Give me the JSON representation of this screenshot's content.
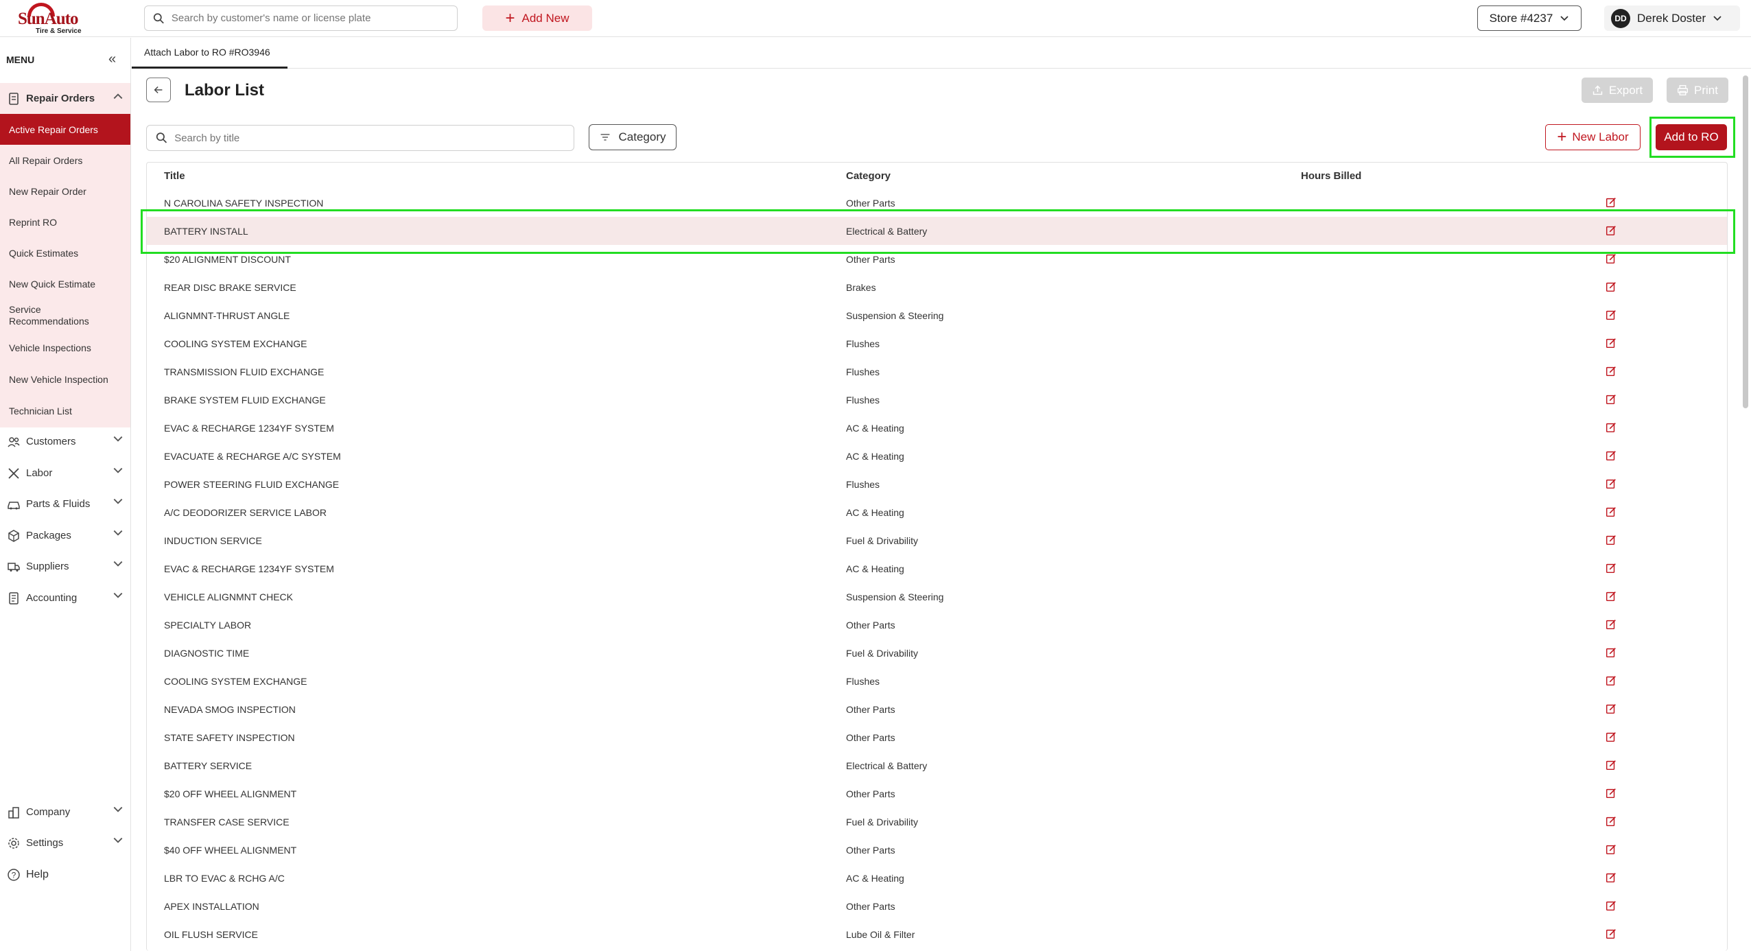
{
  "brand": {
    "name": "SunAuto",
    "tagline": "Tire & Service"
  },
  "topbar": {
    "search_placeholder": "Search by customer's name or license plate",
    "add_new_label": "Add New",
    "store_label": "Store #4237",
    "user_initials": "DD",
    "user_name": "Derek Doster"
  },
  "sidebar": {
    "menu_label": "MENU",
    "repair_orders_label": "Repair Orders",
    "repair_order_items": [
      "Active Repair Orders",
      "All Repair Orders",
      "New Repair Order",
      "Reprint RO",
      "Quick Estimates",
      "New Quick Estimate",
      "Service Recommendations",
      "Vehicle Inspections",
      "New Vehicle Inspection",
      "Technician List"
    ],
    "groups": [
      "Customers",
      "Labor",
      "Parts & Fluids",
      "Packages",
      "Suppliers",
      "Accounting"
    ],
    "bottom_groups": [
      "Company",
      "Settings"
    ],
    "help_label": "Help"
  },
  "tab": {
    "label": "Attach Labor to RO #RO3946"
  },
  "page": {
    "title": "Labor List",
    "export_label": "Export",
    "print_label": "Print",
    "search_placeholder": "Search by title",
    "category_label": "Category",
    "new_labor_label": "New Labor",
    "add_to_ro_label": "Add to RO"
  },
  "table": {
    "columns": [
      "Title",
      "Category",
      "Hours Billed"
    ],
    "selected_index": 1,
    "rows": [
      {
        "title": "N CAROLINA SAFETY INSPECTION",
        "category": "Other Parts"
      },
      {
        "title": "BATTERY INSTALL",
        "category": "Electrical & Battery"
      },
      {
        "title": "$20 ALIGNMENT DISCOUNT",
        "category": "Other Parts"
      },
      {
        "title": "REAR DISC BRAKE SERVICE",
        "category": "Brakes"
      },
      {
        "title": "ALIGNMNT-THRUST ANGLE",
        "category": "Suspension & Steering"
      },
      {
        "title": "COOLING SYSTEM EXCHANGE",
        "category": "Flushes"
      },
      {
        "title": "TRANSMISSION FLUID EXCHANGE",
        "category": "Flushes"
      },
      {
        "title": "BRAKE SYSTEM FLUID EXCHANGE",
        "category": "Flushes"
      },
      {
        "title": "EVAC & RECHARGE 1234YF SYSTEM",
        "category": "AC & Heating"
      },
      {
        "title": "EVACUATE & RECHARGE A/C SYSTEM",
        "category": "AC & Heating"
      },
      {
        "title": "POWER STEERING FLUID EXCHANGE",
        "category": "Flushes"
      },
      {
        "title": "A/C DEODORIZER SERVICE LABOR",
        "category": "AC & Heating"
      },
      {
        "title": "INDUCTION SERVICE",
        "category": "Fuel & Drivability"
      },
      {
        "title": "EVAC & RECHARGE 1234YF SYSTEM",
        "category": "AC & Heating"
      },
      {
        "title": "VEHICLE ALIGNMNT CHECK",
        "category": "Suspension & Steering"
      },
      {
        "title": "SPECIALTY LABOR",
        "category": "Other Parts"
      },
      {
        "title": "DIAGNOSTIC TIME",
        "category": "Fuel & Drivability"
      },
      {
        "title": "COOLING SYSTEM EXCHANGE",
        "category": "Flushes"
      },
      {
        "title": "NEVADA SMOG INSPECTION",
        "category": "Other Parts"
      },
      {
        "title": "STATE SAFETY INSPECTION",
        "category": "Other Parts"
      },
      {
        "title": "BATTERY SERVICE",
        "category": "Electrical & Battery"
      },
      {
        "title": "$20 OFF WHEEL ALIGNMENT",
        "category": "Other Parts"
      },
      {
        "title": "TRANSFER CASE SERVICE",
        "category": "Fuel & Drivability"
      },
      {
        "title": "$40 OFF WHEEL ALIGNMENT",
        "category": "Other Parts"
      },
      {
        "title": "LBR TO EVAC & RCHG A/C",
        "category": "AC & Heating"
      },
      {
        "title": "APEX INSTALLATION",
        "category": "Other Parts"
      },
      {
        "title": "OIL FLUSH SERVICE",
        "category": "Lube Oil & Filter"
      }
    ]
  },
  "colors": {
    "brand": "#b3141d",
    "highlight": "#22dd22",
    "selected_row": "#f6e8e8",
    "sidebar_tint": "#fbe9ea"
  }
}
